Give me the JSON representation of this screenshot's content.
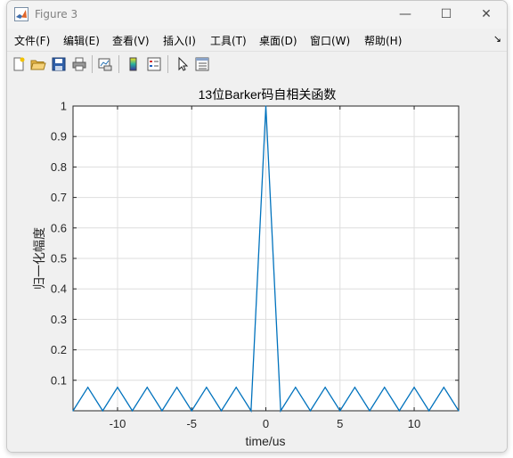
{
  "window": {
    "title": "Figure 3",
    "controls": {
      "minimize": "—",
      "maximize": "☐",
      "close": "✕"
    }
  },
  "menubar": {
    "items": [
      "文件(F)",
      "编辑(E)",
      "查看(V)",
      "插入(I)",
      "工具(T)",
      "桌面(D)",
      "窗口(W)",
      "帮助(H)"
    ],
    "overflow": "↘"
  },
  "toolbar": {
    "icons": [
      "new-figure-icon",
      "open-file-icon",
      "save-icon",
      "print-icon",
      "link-plot-icon",
      "insert-colorbar-icon",
      "insert-legend-icon",
      "pointer-icon",
      "property-editor-icon"
    ]
  },
  "colors": {
    "line": "#0072bd",
    "grid": "#dedede",
    "axes_bg": "#ffffff",
    "figure_bg": "#f0f0f0"
  },
  "chart_data": {
    "type": "line",
    "title": "13位Barker码自相关函数",
    "xlabel": "time/us",
    "ylabel": "归一化幅度",
    "xlim": [
      -13,
      13
    ],
    "ylim": [
      0,
      1
    ],
    "grid": true,
    "xticks": [
      -10,
      -5,
      0,
      5,
      10
    ],
    "xtick_labels": [
      "-10",
      "-5",
      "0",
      "5",
      "10"
    ],
    "yticks": [
      0.1,
      0.2,
      0.3,
      0.4,
      0.5,
      0.6,
      0.7,
      0.8,
      0.9,
      1
    ],
    "ytick_labels": [
      "0.1",
      "0.2",
      "0.3",
      "0.4",
      "0.5",
      "0.6",
      "0.7",
      "0.8",
      "0.9",
      "1"
    ],
    "series": [
      {
        "x": [
          -13,
          -12,
          -11,
          -10,
          -9,
          -8,
          -7,
          -6,
          -5,
          -4,
          -3,
          -2,
          -1,
          0,
          1,
          2,
          3,
          4,
          5,
          6,
          7,
          8,
          9,
          10,
          11,
          12,
          13
        ],
        "y": [
          0,
          0.077,
          0,
          0.077,
          0,
          0.077,
          0,
          0.077,
          0,
          0.077,
          0,
          0.077,
          0,
          1,
          0,
          0.077,
          0,
          0.077,
          0,
          0.077,
          0,
          0.077,
          0,
          0.077,
          0,
          0.077,
          0
        ]
      }
    ]
  }
}
